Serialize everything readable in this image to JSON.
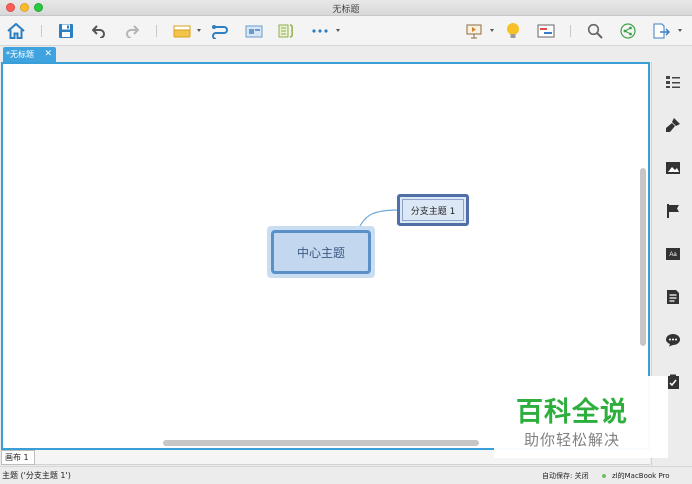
{
  "window": {
    "title": "无标题"
  },
  "tabs": [
    {
      "label": "*无标题",
      "close": "✕"
    }
  ],
  "mindmap": {
    "central_topic": "中心主题",
    "branch_topic": "分支主题 1"
  },
  "sheets": [
    {
      "label": "画布 1"
    }
  ],
  "statusbar": {
    "selection": "主题 ('分支主题 1')",
    "autosave": "自动保存: 关闭",
    "device": "zl的MacBook Pro"
  },
  "watermark": {
    "title": "百科全说",
    "subtitle": "助你轻松解决"
  },
  "colors": {
    "accent": "#3a9fd8",
    "central_fill": "#c3d8ee",
    "central_border": "#5b8fc8",
    "branch_fill": "#dce8f5",
    "branch_border": "#4f6fa6",
    "watermark_green": "#2eae3c"
  },
  "icons": {
    "toolbar": [
      "home-icon",
      "save-icon",
      "undo-icon",
      "redo-icon",
      "topic-insert-icon",
      "relationship-icon",
      "summary-icon",
      "boundary-icon",
      "more-icon",
      "presentation-icon",
      "idea-icon",
      "gantt-icon",
      "search-icon",
      "share-icon",
      "export-icon"
    ],
    "panel": [
      "outline-icon",
      "format-brush-icon",
      "image-icon",
      "flag-icon",
      "text-style-icon",
      "notes-icon",
      "comments-icon",
      "task-icon"
    ]
  }
}
